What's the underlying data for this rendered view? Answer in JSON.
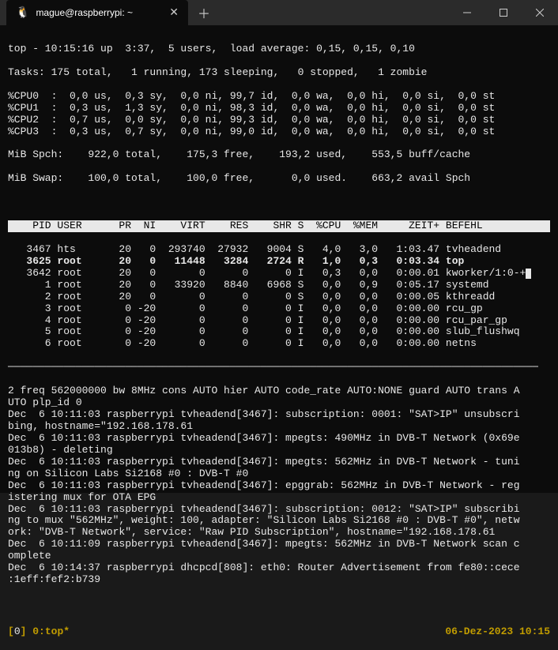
{
  "window": {
    "tab_title": "mague@raspberrypi: ~",
    "tab_icon": "🐧"
  },
  "top": {
    "line1": "top - 10:15:16 up  3:37,  5 users,  load average: 0,15, 0,15, 0,10",
    "line2": "Tasks: 175 total,   1 running, 173 sleeping,   0 stopped,   1 zombie",
    "cpus": [
      "%CPU0  :  0,0 us,  0,3 sy,  0,0 ni, 99,7 id,  0,0 wa,  0,0 hi,  0,0 si,  0,0 st",
      "%CPU1  :  0,3 us,  1,3 sy,  0,0 ni, 98,3 id,  0,0 wa,  0,0 hi,  0,0 si,  0,0 st",
      "%CPU2  :  0,7 us,  0,0 sy,  0,0 ni, 99,3 id,  0,0 wa,  0,0 hi,  0,0 si,  0,0 st",
      "%CPU3  :  0,3 us,  0,7 sy,  0,0 ni, 99,0 id,  0,0 wa,  0,0 hi,  0,0 si,  0,0 st"
    ],
    "mem1": "MiB Spch:    922,0 total,    175,3 free,    193,2 used,    553,5 buff/cache",
    "mem2": "MiB Swap:    100,0 total,    100,0 free,      0,0 used.    663,2 avail Spch"
  },
  "header": "    PID USER      PR  NI    VIRT    RES    SHR S  %CPU  %MEM     ZEIT+ BEFEHL    ",
  "rows": [
    {
      "t": "   3467 hts       20   0  293740  27932   9004 S   4,0   3,0   1:03.47 tvheadend",
      "hl": false
    },
    {
      "t": "   3625 root      20   0   11448   3284   2724 R   1,0   0,3   0:03.34 top",
      "hl": true
    },
    {
      "t": "   3642 root      20   0       0      0      0 I   0,3   0,0   0:00.01 kworker/1:0-+",
      "hl": false,
      "cur": true
    },
    {
      "t": "      1 root      20   0   33920   8840   6968 S   0,0   0,9   0:05.17 systemd",
      "hl": false
    },
    {
      "t": "      2 root      20   0       0      0      0 S   0,0   0,0   0:00.05 kthreadd",
      "hl": false
    },
    {
      "t": "      3 root       0 -20       0      0      0 I   0,0   0,0   0:00.00 rcu_gp",
      "hl": false
    },
    {
      "t": "      4 root       0 -20       0      0      0 I   0,0   0,0   0:00.00 rcu_par_gp",
      "hl": false
    },
    {
      "t": "      5 root       0 -20       0      0      0 I   0,0   0,0   0:00.00 slub_flushwq",
      "hl": false
    },
    {
      "t": "      6 root       0 -20       0      0      0 I   0,0   0,0   0:00.00 netns",
      "hl": false
    }
  ],
  "sep": "──────────────────────────────────────────────────────────────────────────────────────",
  "log": [
    "2 freq 562000000 bw 8MHz cons AUTO hier AUTO code_rate AUTO:NONE guard AUTO trans A",
    "UTO plp_id 0",
    "Dec  6 10:11:03 raspberrypi tvheadend[3467]: subscription: 0001: \"SAT>IP\" unsubscri",
    "bing, hostname=\"192.168.178.61",
    "Dec  6 10:11:03 raspberrypi tvheadend[3467]: mpegts: 490MHz in DVB-T Network (0x69e",
    "013b8) - deleting",
    "Dec  6 10:11:03 raspberrypi tvheadend[3467]: mpegts: 562MHz in DVB-T Network - tuni",
    "ng on Silicon Labs Si2168 #0 : DVB-T #0",
    "Dec  6 10:11:03 raspberrypi tvheadend[3467]: epggrab: 562MHz in DVB-T Network - reg",
    "istering mux for OTA EPG",
    "Dec  6 10:11:03 raspberrypi tvheadend[3467]: subscription: 0012: \"SAT>IP\" subscribi",
    "ng to mux \"562MHz\", weight: 100, adapter: \"Silicon Labs Si2168 #0 : DVB-T #0\", netw",
    "ork: \"DVB-T Network\", service: \"Raw PID Subscription\", hostname=\"192.168.178.61",
    "Dec  6 10:11:09 raspberrypi tvheadend[3467]: mpegts: 562MHz in DVB-T Network scan c",
    "omplete",
    "Dec  6 10:14:37 raspberrypi dhcpcd[808]: eth0: Router Advertisement from fe80::cece",
    ":1eff:fef2:b739"
  ],
  "status": {
    "left_bracket_open": "[",
    "left_num": "0",
    "left_bracket_close": "] ",
    "tmux_win": "0:top*",
    "right": "06-Dez-2023 10:15"
  }
}
